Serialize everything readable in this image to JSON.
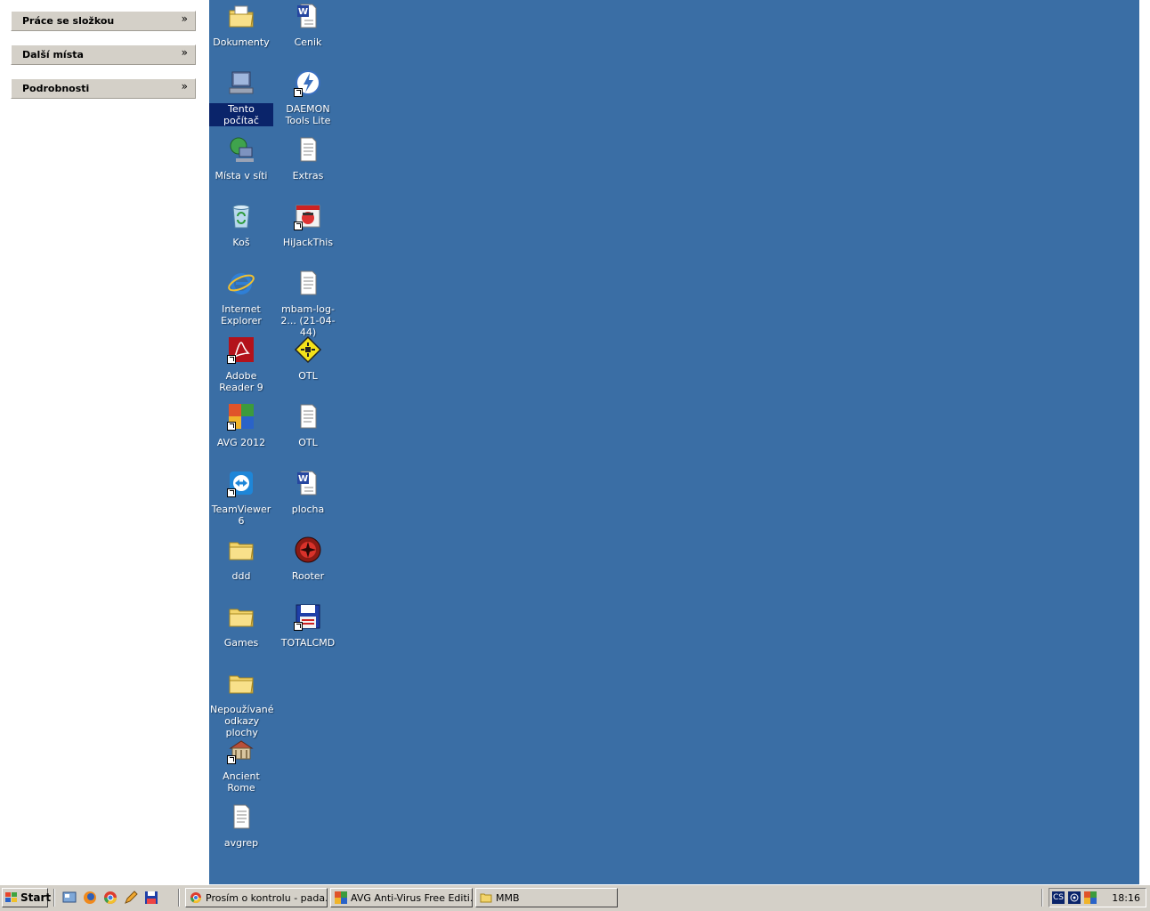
{
  "sidebar": {
    "panels": [
      {
        "title": "Práce se složkou",
        "chevron": "»"
      },
      {
        "title": "Další místa",
        "chevron": "»"
      },
      {
        "title": "Podrobnosti",
        "chevron": "»"
      }
    ]
  },
  "desktop": {
    "background": "#3a6ea5",
    "icons": [
      {
        "label": "Dokumenty",
        "icon": "folder-documents-icon"
      },
      {
        "label": "Tento počítač",
        "icon": "computer-icon",
        "selected": true
      },
      {
        "label": "Místa v síti",
        "icon": "network-places-icon"
      },
      {
        "label": "Koš",
        "icon": "recycle-bin-icon"
      },
      {
        "label": "Internet Explorer",
        "icon": "internet-explorer-icon"
      },
      {
        "label": "Adobe Reader 9",
        "icon": "adobe-reader-icon"
      },
      {
        "label": "AVG 2012",
        "icon": "avg-icon"
      },
      {
        "label": "TeamViewer 6",
        "icon": "teamviewer-icon"
      },
      {
        "label": "ddd",
        "icon": "folder-icon"
      },
      {
        "label": "Games",
        "icon": "folder-icon"
      },
      {
        "label": "Nepoužívané odkazy plochy",
        "icon": "folder-icon"
      },
      {
        "label": "Ancient Rome",
        "icon": "ancient-rome-icon"
      },
      {
        "label": "avgrep",
        "icon": "text-file-icon"
      },
      {
        "label": "Cenik",
        "icon": "word-document-icon"
      },
      {
        "label": "DAEMON Tools Lite",
        "icon": "daemon-tools-icon"
      },
      {
        "label": "Extras",
        "icon": "text-file-icon"
      },
      {
        "label": "HiJackThis",
        "icon": "hijackthis-icon"
      },
      {
        "label": "mbam-log-2... (21-04-44)",
        "icon": "text-file-icon"
      },
      {
        "label": "OTL",
        "icon": "otl-icon"
      },
      {
        "label": "OTL",
        "icon": "text-file-icon"
      },
      {
        "label": "plocha",
        "icon": "word-document-icon"
      },
      {
        "label": "Rooter",
        "icon": "rooter-icon"
      },
      {
        "label": "TOTALCMD",
        "icon": "totalcmd-icon"
      }
    ]
  },
  "taskbar": {
    "start_label": "Start",
    "quick_launch": [
      "show-desktop-icon",
      "firefox-icon",
      "chrome-icon",
      "pencil-icon",
      "floppy-icon"
    ],
    "tasks": [
      {
        "label": "Prosím o kontrolu - pada...",
        "icon": "chrome-icon"
      },
      {
        "label": "AVG Anti-Virus Free Editi...",
        "icon": "avg-icon"
      },
      {
        "label": "MMB",
        "icon": "folder-icon"
      }
    ],
    "tray": {
      "language": "CS",
      "clock": "18:16"
    }
  }
}
